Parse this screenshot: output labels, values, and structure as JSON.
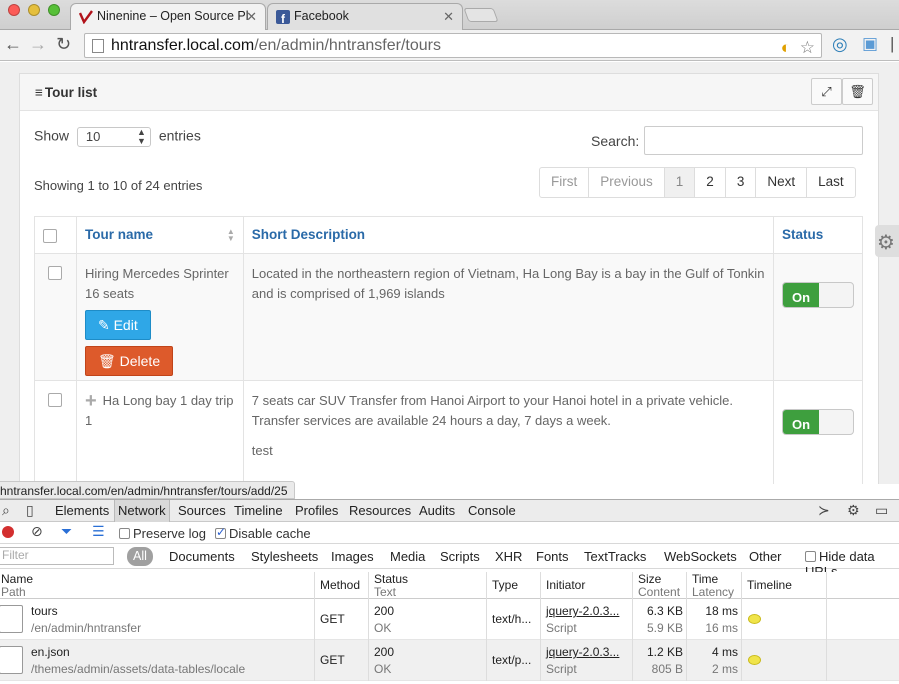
{
  "browser": {
    "tabs": [
      {
        "title": "Ninenine – Open Source Pl",
        "active": true
      },
      {
        "title": "Facebook",
        "active": false
      }
    ],
    "url_host": "hntransfer.local.com",
    "url_path": "/en/admin/hntransfer/tours"
  },
  "panel": {
    "title": "Tour list"
  },
  "list": {
    "show_label": "Show",
    "show_value": "10",
    "entries_label": "entries",
    "search_label": "Search:",
    "info": "Showing 1 to 10 of 24 entries"
  },
  "pagination": [
    "First",
    "Previous",
    "1",
    "2",
    "3",
    "Next",
    "Last"
  ],
  "table": {
    "headers": [
      "Tour name",
      "Short Description",
      "Status"
    ],
    "rows": [
      {
        "name": "Hiring Mercedes Sprinter 16 seats",
        "description": "Located in the northeastern region of Vietnam, Ha Long Bay is a bay in the Gulf of Tonkin and is comprised of 1,969 islands",
        "extra": "",
        "status": "On"
      },
      {
        "name": "Ha Long bay 1 day trip 1",
        "description": "7 seats car SUV Transfer from Hanoi Airport to your Hanoi hotel in a private vehicle. Transfer services are available 24 hours a day, 7 days a week.",
        "extra": "test",
        "status": "On"
      }
    ],
    "edit_label": "Edit",
    "delete_label": "Delete"
  },
  "status_url": "hntransfer.local.com/en/admin/hntransfer/tours/add/25",
  "devtools": {
    "tabs": [
      "Elements",
      "Network",
      "Sources",
      "Timeline",
      "Profiles",
      "Resources",
      "Audits",
      "Console"
    ],
    "preserve_log": "Preserve log",
    "disable_cache": "Disable cache",
    "filter_placeholder": "Filter",
    "filter_all": "All",
    "filter_types": [
      "Documents",
      "Stylesheets",
      "Images",
      "Media",
      "Scripts",
      "XHR",
      "Fonts",
      "TextTracks",
      "WebSockets",
      "Other"
    ],
    "hide_data_urls": "Hide data URLs",
    "columns": {
      "name": "Name",
      "path": "Path",
      "method": "Method",
      "status": "Status",
      "status_text": "Text",
      "type": "Type",
      "initiator": "Initiator",
      "size": "Size",
      "content": "Content",
      "time": "Time",
      "latency": "Latency",
      "timeline": "Timeline"
    },
    "requests": [
      {
        "name": "tours",
        "path": "/en/admin/hntransfer",
        "method": "GET",
        "status": "200",
        "status_text": "OK",
        "type": "text/h...",
        "initiator": "jquery-2.0.3...",
        "initiator_type": "Script",
        "size": "6.3 KB",
        "content": "5.9 KB",
        "time": "18 ms",
        "latency": "16 ms"
      },
      {
        "name": "en.json",
        "path": "/themes/admin/assets/data-tables/locale",
        "method": "GET",
        "status": "200",
        "status_text": "OK",
        "type": "text/p...",
        "initiator": "jquery-2.0.3...",
        "initiator_type": "Script",
        "size": "1.2 KB",
        "content": "805 B",
        "time": "4 ms",
        "latency": "2 ms"
      }
    ]
  }
}
